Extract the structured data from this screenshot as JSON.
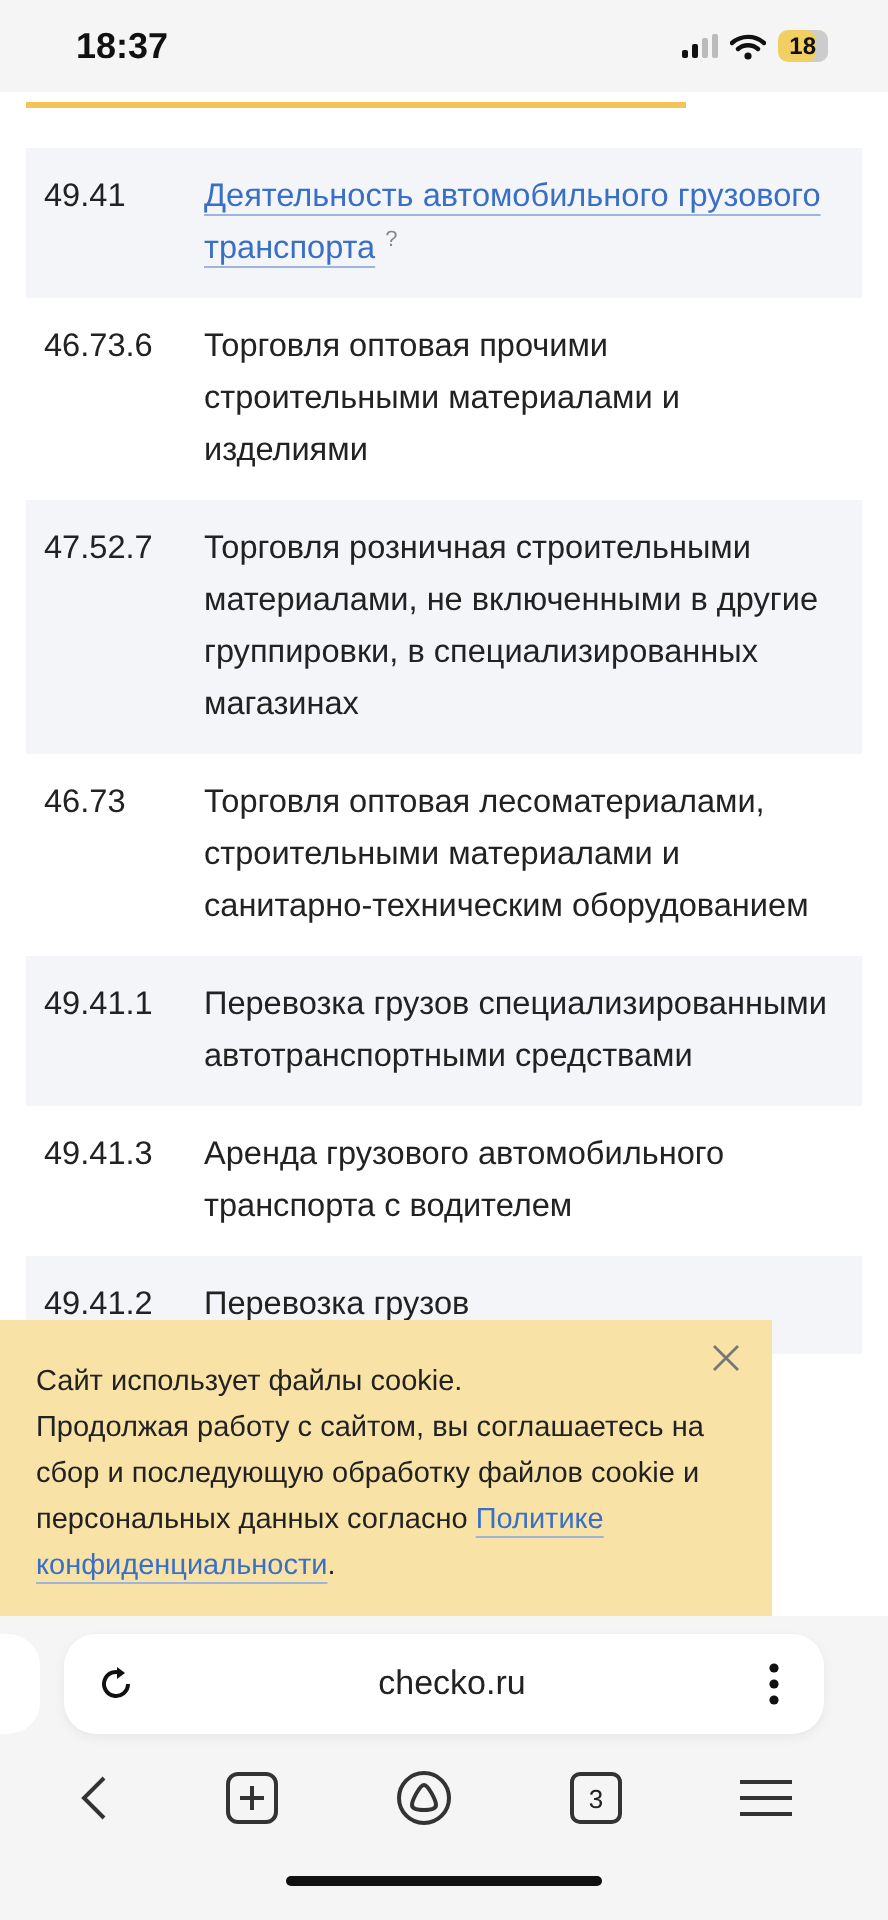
{
  "status_bar": {
    "time": "18:37",
    "battery": "18"
  },
  "activities": [
    {
      "code": "49.41",
      "name": "Деятельность автомобильного грузового транспорта",
      "kind": "link",
      "help": "?"
    },
    {
      "code": "46.73.6",
      "name": "Торговля оптовая прочими строительными материалами и изделиями",
      "kind": "text"
    },
    {
      "code": "47.52.7",
      "name": "Торговля розничная строительными материалами, не включенными в другие группировки, в специализированных магазинах",
      "kind": "text"
    },
    {
      "code": "46.73",
      "name": "Торговля оптовая лесоматериалами, строительными материалами и санитарно-техническим оборудованием",
      "kind": "text"
    },
    {
      "code": "49.41.1",
      "name": "Перевозка грузов специализированными автотранспортными средствами",
      "kind": "text"
    },
    {
      "code": "49.41.3",
      "name": "Аренда грузового автомобильного транспорта с водителем",
      "kind": "text"
    },
    {
      "code": "49.41.2",
      "name": "Перевозка грузов",
      "kind": "text"
    }
  ],
  "cookie_banner": {
    "title": "Сайт использует файлы cookie.",
    "text": "Продолжая работу с сайтом, вы соглашаетесь на сбор и последующую обработку файлов cookie и персональных данных согласно ",
    "link": [
      "Политике",
      "конфиденциальности"
    ],
    "after": "."
  },
  "browser": {
    "url": "checko.ru",
    "tab_count": "3"
  }
}
